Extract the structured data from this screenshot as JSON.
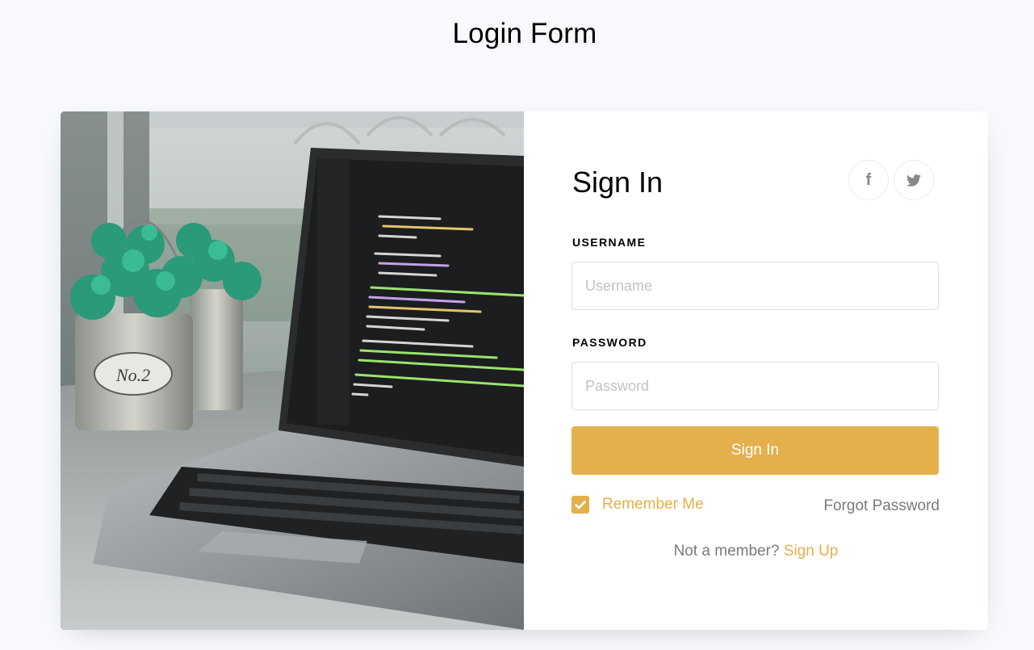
{
  "page": {
    "title": "Login Form"
  },
  "photo": {
    "plant_tag": "No.2"
  },
  "form": {
    "heading": "Sign In",
    "social": [
      {
        "icon": "facebook-icon",
        "glyph": "f"
      },
      {
        "icon": "twitter-icon"
      }
    ],
    "username": {
      "label": "USERNAME",
      "placeholder": "Username",
      "value": ""
    },
    "password": {
      "label": "PASSWORD",
      "placeholder": "Password",
      "value": ""
    },
    "submit_label": "Sign In",
    "remember": {
      "label": "Remember Me",
      "checked": true
    },
    "forgot_label": "Forgot Password",
    "signup": {
      "prompt": "Not a member?",
      "link": "Sign Up"
    }
  },
  "colors": {
    "accent": "#e3b04b",
    "background": "#f8f9fd",
    "muted_text": "#7a7a7a"
  }
}
